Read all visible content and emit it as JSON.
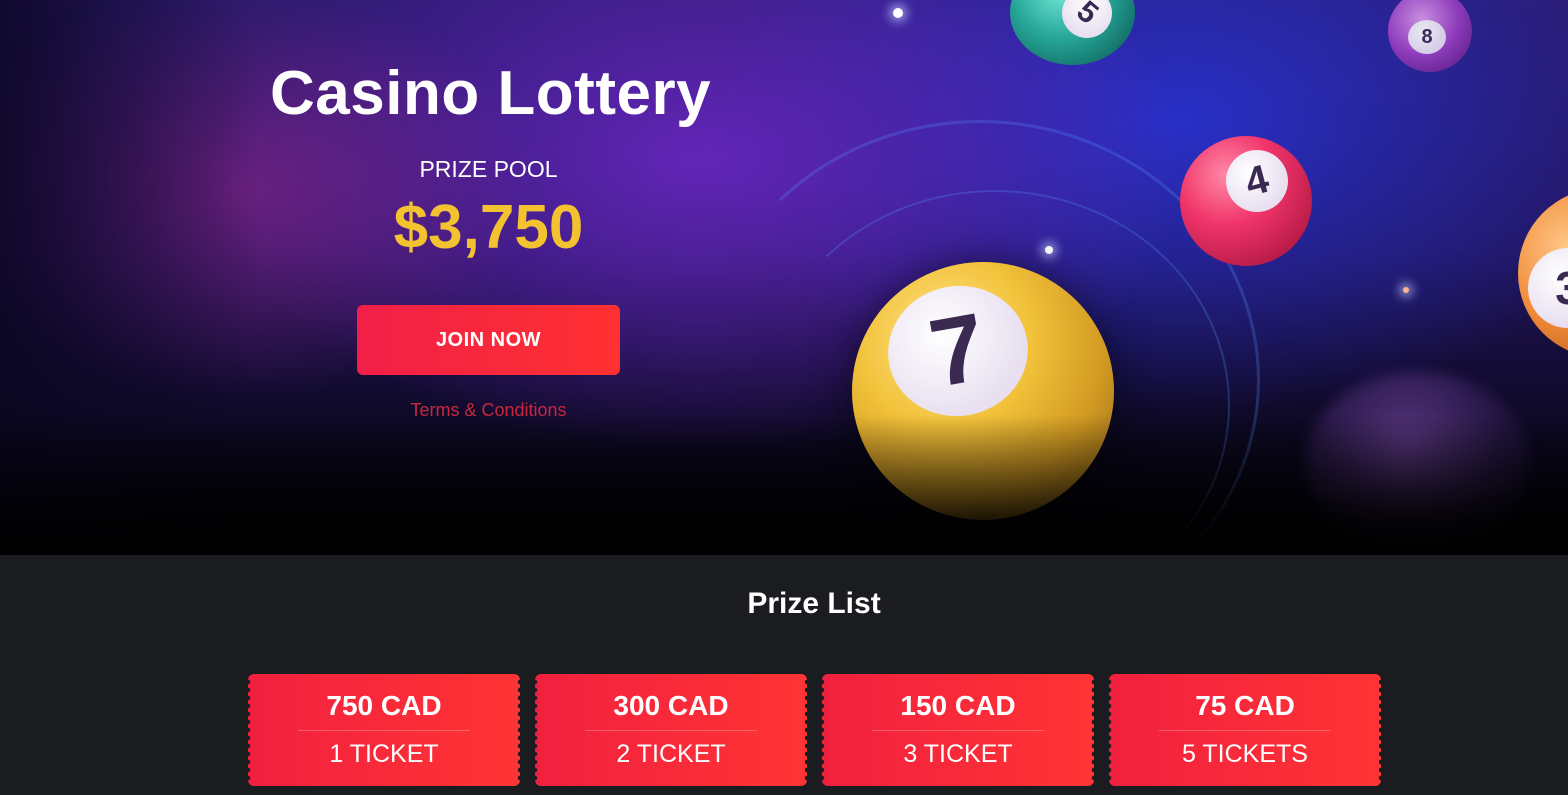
{
  "hero": {
    "title": "Casino Lottery",
    "prize_pool_label": "PRIZE POOL",
    "prize_pool_amount": "$3,750",
    "join_button_label": "JOIN NOW",
    "terms_link": "Terms & Conditions",
    "balls": [
      "7",
      "4",
      "5",
      "8",
      "3"
    ]
  },
  "prize_list": {
    "heading": "Prize List",
    "prizes": [
      {
        "amount": "750 CAD",
        "tickets": "1 TICKET"
      },
      {
        "amount": "300 CAD",
        "tickets": "2 TICKET"
      },
      {
        "amount": "150 CAD",
        "tickets": "3 TICKET"
      },
      {
        "amount": "75 CAD",
        "tickets": "5 TICKETS"
      }
    ]
  },
  "colors": {
    "accent_red": "#f2203f",
    "prize_gold": "#f2c230",
    "terms_red": "#c8283d",
    "section_bg": "#1b1c20"
  }
}
